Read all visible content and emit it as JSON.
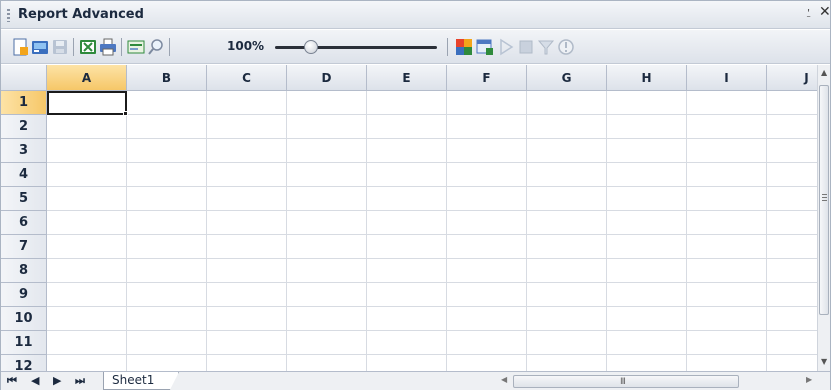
{
  "panel": {
    "title": "Report Advanced",
    "pin_glyph": "ᴪ",
    "close_glyph": "×",
    "pin_icon": "pin-icon",
    "close_icon": "close-icon"
  },
  "toolbar": {
    "zoom_label": "100%",
    "zoom_slider_fraction": 0.22,
    "buttons": [
      {
        "name": "new-report-icon",
        "enabled": true
      },
      {
        "name": "open-icon",
        "enabled": true
      },
      {
        "name": "save-icon",
        "enabled": false
      },
      {
        "name": "export-excel-icon",
        "enabled": true
      },
      {
        "name": "print-icon",
        "enabled": true
      },
      {
        "name": "design-view-icon",
        "enabled": true
      },
      {
        "name": "zoom-icon",
        "enabled": true
      },
      {
        "name": "color-palette-icon",
        "enabled": true
      },
      {
        "name": "insert-table-icon",
        "enabled": true
      },
      {
        "name": "run-icon",
        "enabled": false
      },
      {
        "name": "stop-icon",
        "enabled": false
      },
      {
        "name": "filter-icon",
        "enabled": false
      },
      {
        "name": "info-icon",
        "enabled": false
      }
    ]
  },
  "grid": {
    "columns": [
      "A",
      "B",
      "C",
      "D",
      "E",
      "F",
      "G",
      "H",
      "I",
      "J"
    ],
    "rows": [
      "1",
      "2",
      "3",
      "4",
      "5",
      "6",
      "7",
      "8",
      "9",
      "10",
      "11",
      "12"
    ],
    "selected_cell": "A1"
  },
  "sheets": {
    "nav": [
      "⏮",
      "◀",
      "▶",
      "⏭"
    ],
    "tabs": [
      "Sheet1"
    ],
    "hscroll_grip": "III"
  },
  "colors": {
    "selected_header": "#f6c768",
    "gridline": "#d7dbe2",
    "header_bg": "#dde2ea"
  }
}
